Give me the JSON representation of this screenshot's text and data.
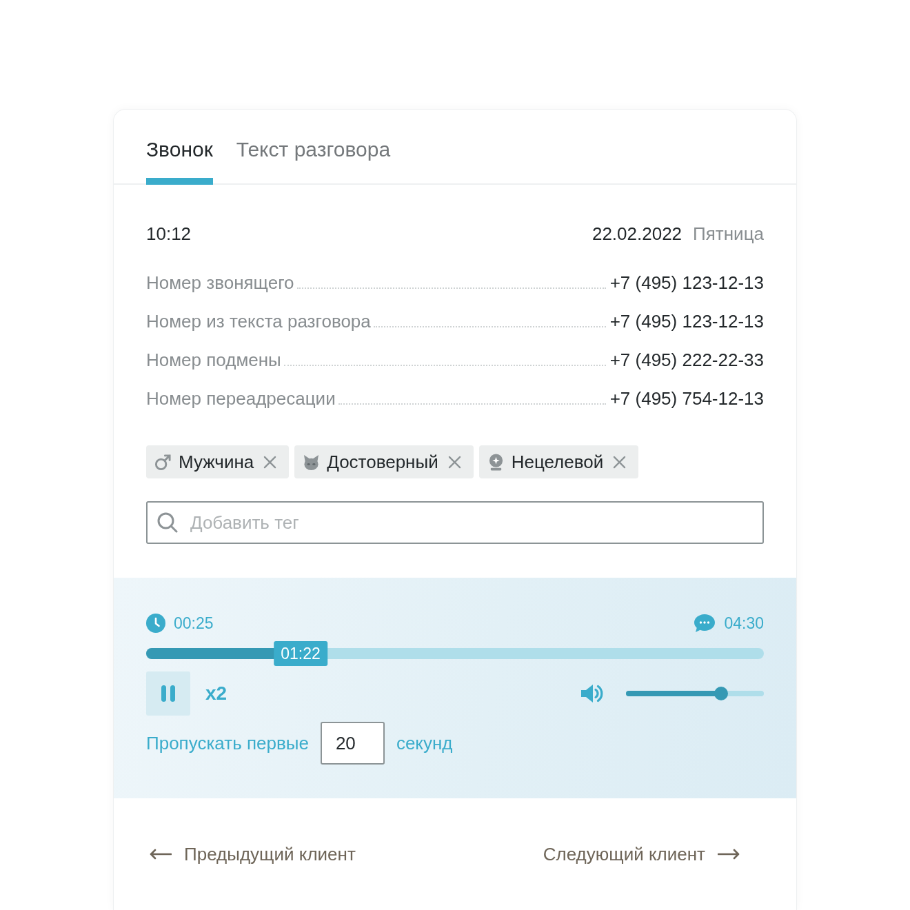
{
  "tabs": [
    {
      "label": "Звонок",
      "selected": true
    },
    {
      "label": "Текст разговора",
      "selected": false
    }
  ],
  "call": {
    "time": "10:12",
    "date": "22.02.2022",
    "weekday": "Пятница"
  },
  "numbers": [
    {
      "label": "Номер звонящего",
      "value": "+7 (495) 123-12-13"
    },
    {
      "label": "Номер из текста разговора",
      "value": "+7 (495) 123-12-13"
    },
    {
      "label": "Номер подмены",
      "value": "+7 (495) 222-22-33"
    },
    {
      "label": "Номер переадресации",
      "value": "+7 (495) 754-12-13"
    }
  ],
  "tags": [
    {
      "label": "Мужчина",
      "kind": "male"
    },
    {
      "label": "Достоверный",
      "kind": "cat"
    },
    {
      "label": "Нецелевой",
      "kind": "crystal-ball"
    }
  ],
  "tag_search": {
    "placeholder": "Добавить тег"
  },
  "player": {
    "elapsed": "00:25",
    "duration": "04:30",
    "position": "01:22",
    "level": 0.25,
    "playing": true,
    "speed": "x2",
    "volume": {
      "level": 0.69
    }
  },
  "skip": {
    "label": "Пропускать первые",
    "value": "20",
    "unit": "секунд"
  },
  "navigation": {
    "previous": "Предыдущий клиент",
    "next": "Следующий клиент"
  }
}
